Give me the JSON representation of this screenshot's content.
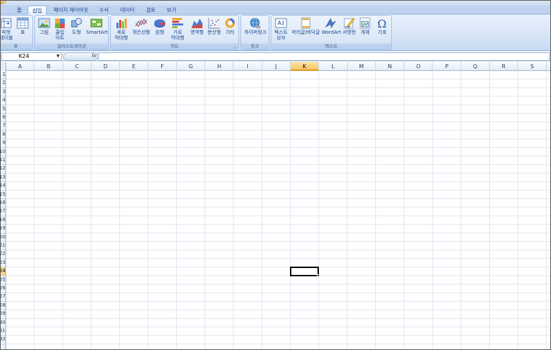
{
  "tabs": [
    {
      "label": "홈",
      "active": false
    },
    {
      "label": "삽입",
      "active": true
    },
    {
      "label": "페이지 레이아웃",
      "active": false
    },
    {
      "label": "수식",
      "active": false
    },
    {
      "label": "데이터",
      "active": false
    },
    {
      "label": "검토",
      "active": false
    },
    {
      "label": "보기",
      "active": false
    }
  ],
  "ribbon": {
    "groups": [
      {
        "label": "표",
        "buttons": [
          {
            "label": "피벗\n테이블",
            "icon": "pivot-table-icon"
          },
          {
            "label": "표",
            "icon": "table-icon"
          }
        ]
      },
      {
        "label": "일러스트레이션",
        "buttons": [
          {
            "label": "그림",
            "icon": "picture-icon"
          },
          {
            "label": "클립\n아트",
            "icon": "clipart-icon"
          },
          {
            "label": "도형",
            "icon": "shapes-icon"
          },
          {
            "label": "SmartArt",
            "icon": "smartart-icon"
          }
        ]
      },
      {
        "label": "차트",
        "buttons": [
          {
            "label": "세로\n막대형",
            "icon": "column-chart-icon"
          },
          {
            "label": "꺾은선형",
            "icon": "line-chart-icon"
          },
          {
            "label": "원형",
            "icon": "pie-chart-icon"
          },
          {
            "label": "가로\n막대형",
            "icon": "bar-chart-icon"
          },
          {
            "label": "영역형",
            "icon": "area-chart-icon"
          },
          {
            "label": "분산형",
            "icon": "scatter-chart-icon"
          },
          {
            "label": "기타",
            "icon": "other-charts-icon"
          }
        ]
      },
      {
        "label": "링크",
        "buttons": [
          {
            "label": "하이퍼링크",
            "icon": "hyperlink-icon"
          }
        ]
      },
      {
        "label": "텍스트",
        "buttons": [
          {
            "label": "텍스트\n상자",
            "icon": "textbox-icon"
          },
          {
            "label": "머리글/바닥글",
            "icon": "header-footer-icon"
          },
          {
            "label": "WordArt",
            "icon": "wordart-icon"
          },
          {
            "label": "서명란",
            "icon": "signature-line-icon"
          },
          {
            "label": "개체",
            "icon": "object-icon"
          },
          {
            "label": "기호",
            "icon": "symbol-icon"
          }
        ]
      }
    ]
  },
  "formula_bar": {
    "name_box": "K24",
    "fx_label": "fx",
    "formula": ""
  },
  "grid": {
    "columns": [
      "A",
      "B",
      "C",
      "D",
      "E",
      "F",
      "G",
      "H",
      "I",
      "J",
      "K",
      "L",
      "M",
      "N",
      "O",
      "P",
      "Q",
      "R",
      "S"
    ],
    "active_column": "K",
    "rows": [
      "1",
      "2",
      "3",
      "4",
      "5",
      "6",
      "7",
      "8",
      "9",
      "10",
      "11",
      "12",
      "13",
      "14",
      "15",
      "16",
      "17",
      "18",
      "19",
      "20",
      "21",
      "22",
      "23",
      "24",
      "25",
      "26",
      "27",
      "28",
      "29",
      "30",
      "31",
      "32"
    ],
    "active_row": "24",
    "active_cell": "K24"
  },
  "colors": {
    "accent": "#15428b",
    "header_highlight": "#f9c664",
    "gridline": "#dde6f1"
  }
}
